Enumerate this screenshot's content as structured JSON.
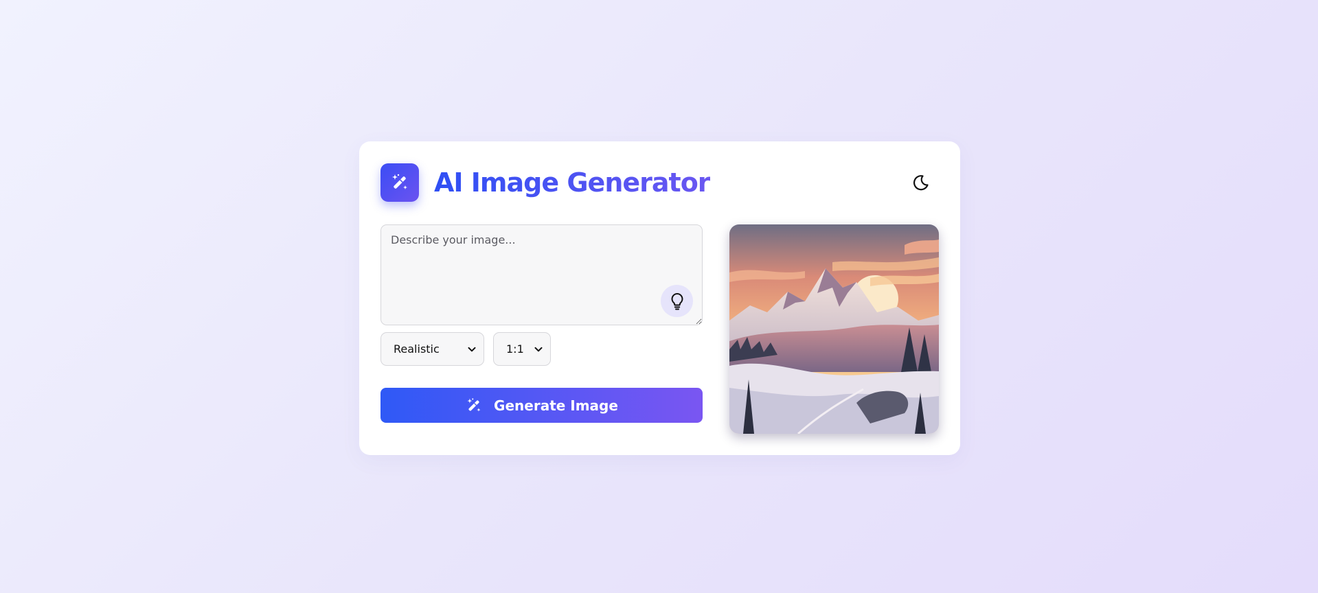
{
  "app": {
    "title": "AI Image Generator"
  },
  "icons": {
    "logo": "magic-wand-icon",
    "theme_toggle": "moon-icon",
    "prompt_suggestion": "lightbulb-icon",
    "generate": "magic-wand-icon"
  },
  "prompt": {
    "placeholder": "Describe your image...",
    "value": ""
  },
  "controls": {
    "style": {
      "selected": "Realistic"
    },
    "aspect_ratio": {
      "selected": "1:1"
    },
    "generate_label": "Generate Image"
  },
  "preview": {
    "subject": "illustrated snowy mountain landscape at sunset"
  },
  "colors": {
    "accent_start": "#2f59f6",
    "accent_end": "#7a56f2",
    "page_bg_start": "#f1f2fe",
    "page_bg_end": "#e4dcfb",
    "card_bg": "#ffffff"
  }
}
